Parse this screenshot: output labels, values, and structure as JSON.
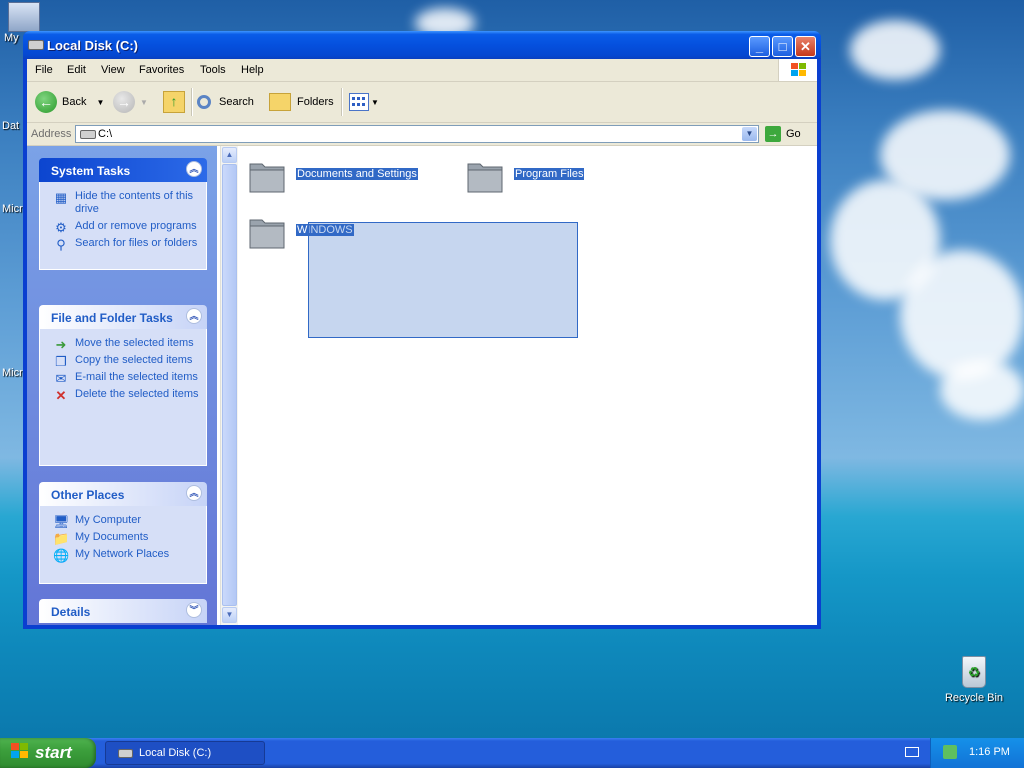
{
  "window": {
    "title": "Local Disk (C:)",
    "controls": {
      "minimize": "_",
      "maximize": "□",
      "close": "✕"
    }
  },
  "menu": [
    "File",
    "Edit",
    "View",
    "Favorites",
    "Tools",
    "Help"
  ],
  "toolbar": {
    "back": "Back",
    "search": "Search",
    "folders": "Folders"
  },
  "address": {
    "label": "Address",
    "value": "C:\\",
    "go": "Go"
  },
  "task_pane": {
    "system_tasks": {
      "title": "System Tasks",
      "items": [
        "Hide the contents of this drive",
        "Add or remove programs",
        "Search for files or folders"
      ]
    },
    "file_folder_tasks": {
      "title": "File and Folder Tasks",
      "items": [
        "Move the selected items",
        "Copy the selected items",
        "E-mail the selected items",
        "Delete the selected items"
      ]
    },
    "other_places": {
      "title": "Other Places",
      "items": [
        "My Computer",
        "My Documents",
        "My Network Places"
      ]
    },
    "details": {
      "title": "Details"
    }
  },
  "folders": [
    "Documents and Settings",
    "Program Files",
    "WINDOWS"
  ],
  "desktop": {
    "icons": [
      "My",
      "Dat",
      "Micro",
      "Micro",
      "Recycle Bin"
    ]
  },
  "taskbar": {
    "start": "start",
    "task_button": "Local Disk (C:)",
    "clock": "1:16 PM"
  },
  "colors": {
    "selection": "#3169c6",
    "task_pane_bg": "#7ba2e7",
    "title_bar": "#0550de"
  }
}
